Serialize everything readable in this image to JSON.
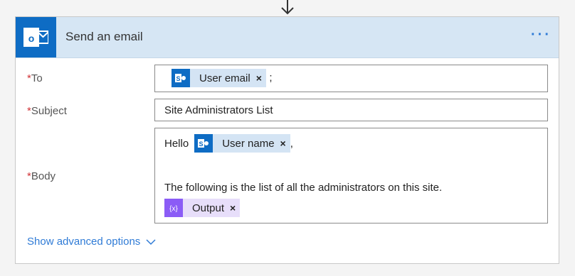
{
  "header": {
    "title": "Send an email",
    "more_label": "···",
    "app_icon": "outlook-icon"
  },
  "fields": {
    "to": {
      "required_mark": "*",
      "label": "To",
      "token_label": "User email",
      "token_close": "×",
      "separator": ";"
    },
    "subject": {
      "required_mark": "*",
      "label": "Subject",
      "value": "Site Administrators List"
    },
    "body": {
      "required_mark": "*",
      "label": "Body",
      "greeting": "Hello",
      "name_token": "User name",
      "name_close": "×",
      "comma": ",",
      "line": "The following is the list of all the administrators on this site.",
      "output_token": "Output",
      "output_close": "×"
    }
  },
  "advanced": {
    "label": "Show advanced options"
  },
  "colors": {
    "header_bg": "#d6e6f4",
    "accent": "#0e6cc4",
    "link": "#2f7bd6",
    "required": "#d13438",
    "expression": "#8b5cf6"
  }
}
